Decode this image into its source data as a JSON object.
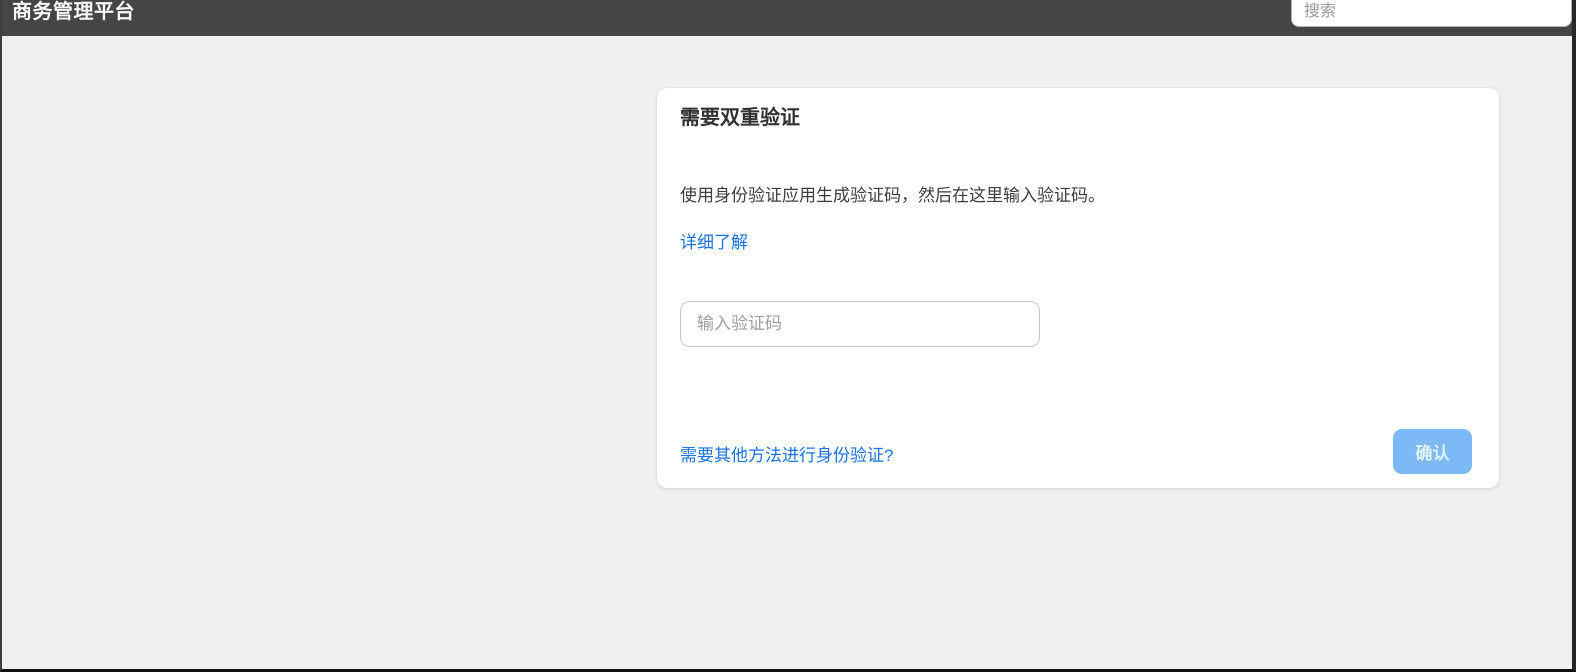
{
  "header": {
    "app_title": "商务管理平台",
    "search_placeholder": "搜索"
  },
  "card": {
    "title": "需要双重验证",
    "description": "使用身份验证应用生成验证码，然后在这里输入验证码。",
    "learn_more_label": "详细了解",
    "code_input_placeholder": "输入验证码",
    "code_input_value": "",
    "alt_method_label": "需要其他方法进行身份验证?",
    "confirm_label": "确认"
  },
  "colors": {
    "topbar_bg": "#454545",
    "page_bg": "#f1f0ef",
    "card_bg": "#ffffff",
    "link_blue": "#1a73e8",
    "confirm_button_bg": "#7db9f7"
  }
}
